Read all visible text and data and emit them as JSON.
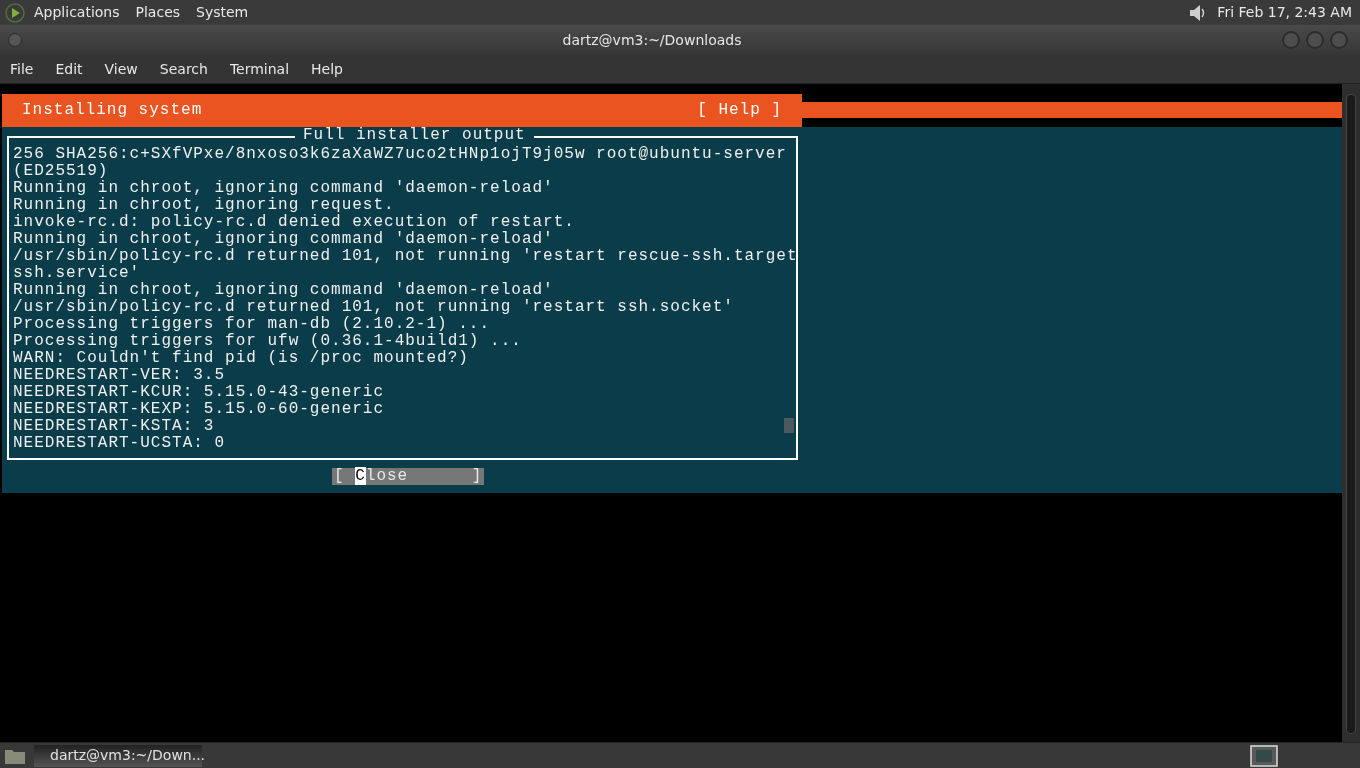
{
  "top_panel": {
    "menus": [
      "Applications",
      "Places",
      "System"
    ],
    "clock": "Fri Feb 17, 2:43 AM"
  },
  "window": {
    "title": "dartz@vm3:~/Downloads"
  },
  "menu_bar": [
    "File",
    "Edit",
    "View",
    "Search",
    "Terminal",
    "Help"
  ],
  "installer": {
    "title": "Installing system",
    "help": "[ Help ]",
    "dialog_title": "Full installer output",
    "lines": [
      "256 SHA256:c+SXfVPxe/8nxoso3k6zaXaWZ7uco2tHNp1ojT9j05w root@ubuntu-server",
      "(ED25519)",
      "Running in chroot, ignoring command 'daemon-reload'",
      "Running in chroot, ignoring request.",
      "invoke-rc.d: policy-rc.d denied execution of restart.",
      "Running in chroot, ignoring command 'daemon-reload'",
      "/usr/sbin/policy-rc.d returned 101, not running 'restart rescue-ssh.target",
      "ssh.service'",
      "Running in chroot, ignoring command 'daemon-reload'",
      "/usr/sbin/policy-rc.d returned 101, not running 'restart ssh.socket'",
      "Processing triggers for man-db (2.10.2-1) ...",
      "Processing triggers for ufw (0.36.1-4build1) ...",
      "WARN: Couldn't find pid (is /proc mounted?)",
      "NEEDRESTART-VER: 3.5",
      "NEEDRESTART-KCUR: 5.15.0-43-generic",
      "NEEDRESTART-KEXP: 5.15.0-60-generic",
      "NEEDRESTART-KSTA: 3",
      "NEEDRESTART-UCSTA: 0"
    ],
    "close_button": "[ Close      ]"
  },
  "taskbar": {
    "tasks": [
      {
        "label": "dartz@vm3:~/Down...",
        "selected": true
      }
    ]
  }
}
